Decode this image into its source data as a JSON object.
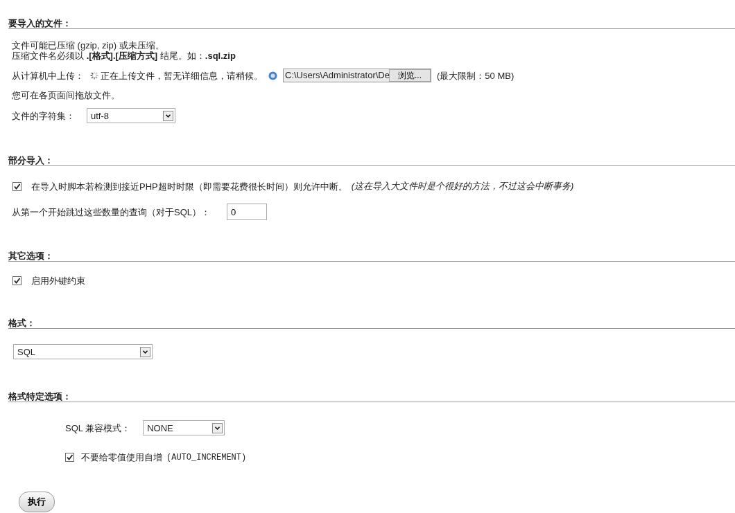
{
  "file_section": {
    "heading": "要导入的文件：",
    "hint_lines": [
      "文件可能已压缩 (gzip, zip) 或未压缩。",
      "压缩文件名必须以 **.[格式].[压缩方式]** 结尾。如：**.sql.zip**"
    ],
    "upload_label": "从计算机中上传：",
    "upload_status": "正在上传文件，暂无详细信息，请稍候。",
    "file_value": "C:\\Users\\Administrator\\De",
    "browse_button": "浏览...",
    "max_size": "(最大限制：50 MB)",
    "drag_hint": "您可在各页面间拖放文件。",
    "charset_label": "文件的字符集：",
    "charset_value": "utf-8"
  },
  "partial_section": {
    "heading": "部分导入：",
    "allow_interrupt": {
      "label": "在导入时脚本若检测到接近PHP超时时限（即需要花费很长时间）则允许中断。",
      "note": "(这在导入大文件时是个很好的方法，不过这会中断事务)",
      "checked": true
    },
    "skip_label": "从第一个开始跳过这些数量的查询（对于SQL）：",
    "skip_value": "0"
  },
  "other_section": {
    "heading": "其它选项：",
    "foreign_keys": {
      "label": "启用外键约束",
      "checked": true
    }
  },
  "format_section": {
    "heading": "格式：",
    "format_value": "SQL"
  },
  "format_options_section": {
    "heading": "格式特定选项：",
    "compat_label": "SQL 兼容模式：",
    "compat_value": "NONE",
    "no_auto_value": {
      "label": "不要给零值使用自增 ",
      "code": "(AUTO_INCREMENT)",
      "checked": true
    }
  },
  "submit_button": "执行"
}
